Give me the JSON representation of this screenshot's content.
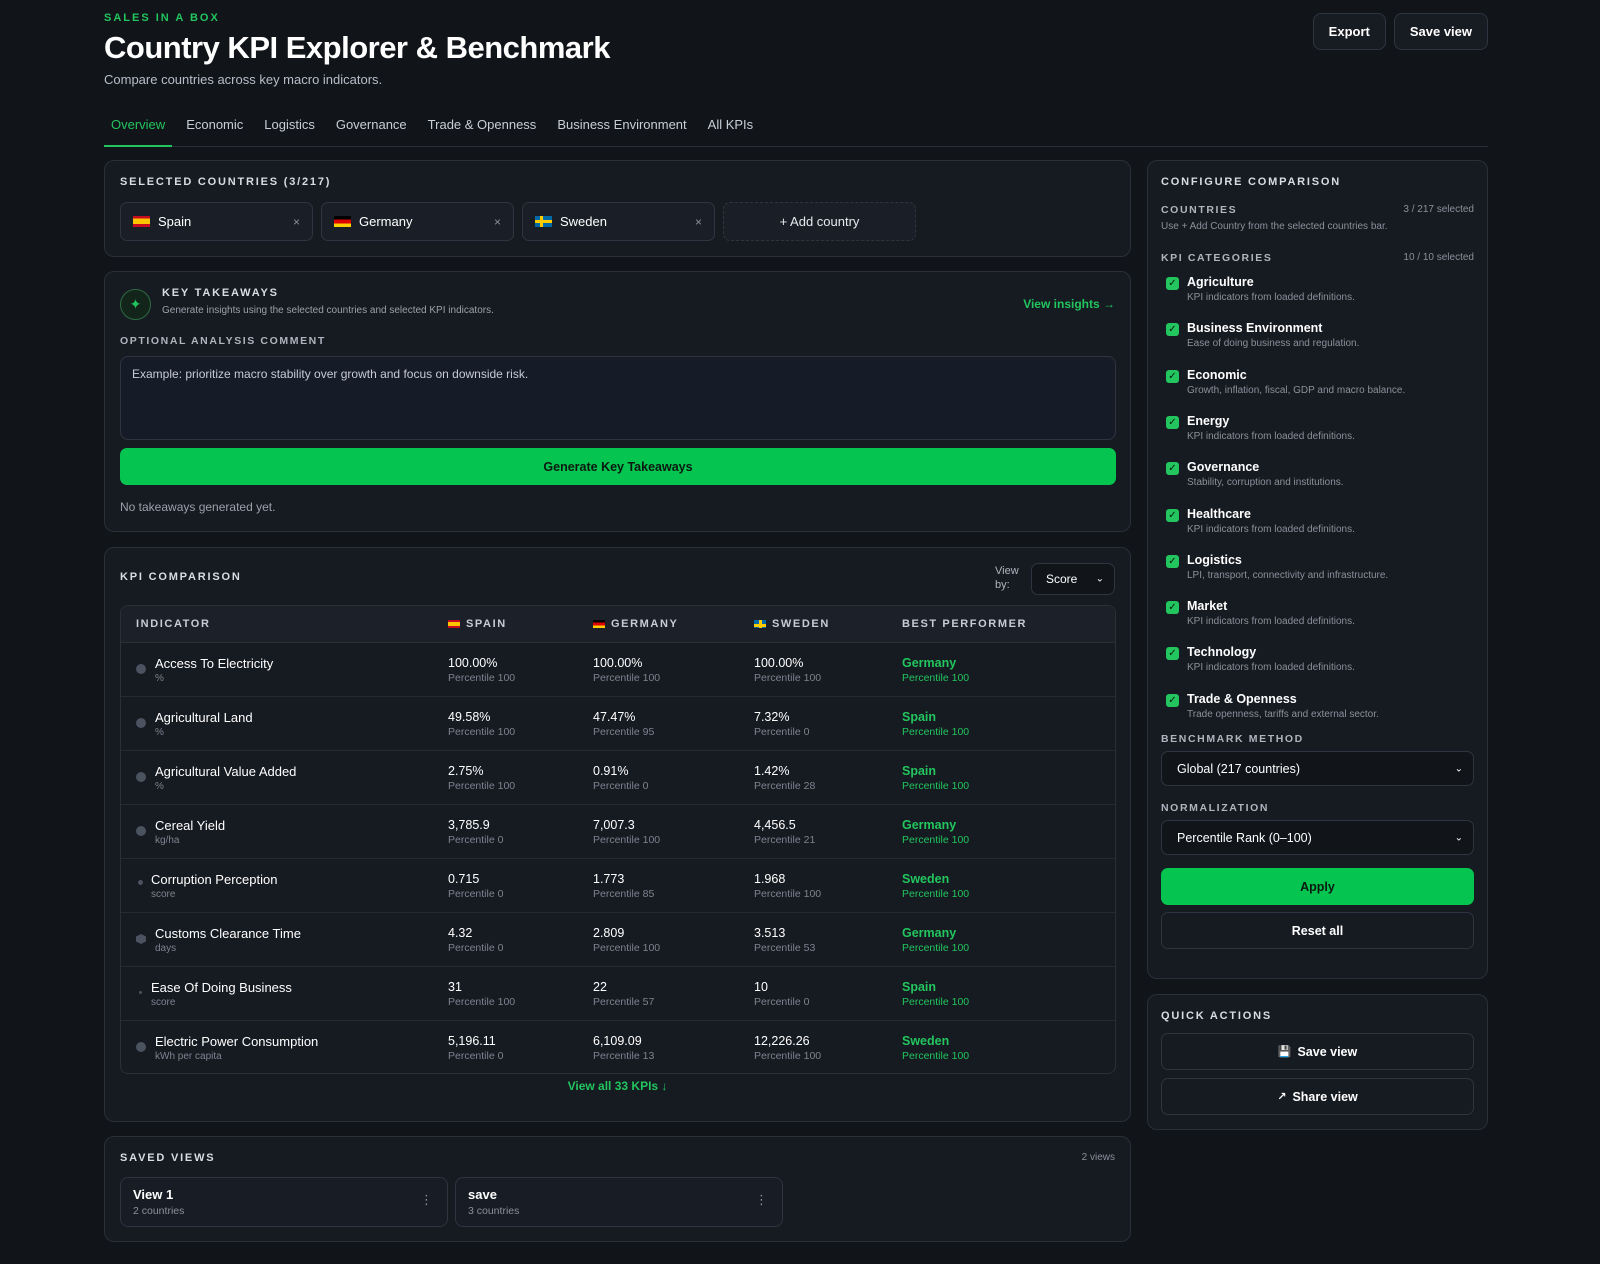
{
  "header": {
    "brand": "SALES IN A BOX",
    "title": "Country KPI Explorer & Benchmark",
    "subtitle": "Compare countries across key macro indicators.",
    "export_label": "Export",
    "save_view_label": "Save view"
  },
  "tabs": [
    {
      "label": "Overview",
      "active": true
    },
    {
      "label": "Economic"
    },
    {
      "label": "Logistics"
    },
    {
      "label": "Governance"
    },
    {
      "label": "Trade & Openness"
    },
    {
      "label": "Business Environment"
    },
    {
      "label": "All KPIs"
    }
  ],
  "selected": {
    "title": "SELECTED COUNTRIES (3/217)",
    "chips": [
      {
        "name": "Spain",
        "flag": "es-flag-icon",
        "remove": "×"
      },
      {
        "name": "Germany",
        "flag": "de-flag-icon",
        "remove": "×"
      },
      {
        "name": "Sweden",
        "flag": "se-flag-icon",
        "remove": "×"
      }
    ],
    "add_label": "+ Add country"
  },
  "takeaways": {
    "icon": "✦",
    "title": "KEY TAKEAWAYS",
    "subtitle": "Generate insights using the selected countries and selected KPI indicators.",
    "view_link": "View insights →",
    "comment_label": "OPTIONAL ANALYSIS COMMENT",
    "comment_placeholder": "Example: prioritize macro stability over growth and focus on downside risk.",
    "generate_label": "Generate Key Takeaways",
    "empty": "No takeaways generated yet."
  },
  "kpi": {
    "title": "KPI COMPARISON",
    "view_by_label": "View by:",
    "view_by_value": "Score",
    "headers": {
      "indicator": "INDICATOR",
      "spain": "SPAIN",
      "germany": "GERMANY",
      "sweden": "SWEDEN",
      "best": "BEST PERFORMER"
    },
    "rows": [
      {
        "name": "Access To Electricity",
        "unit": "%",
        "es": "100.00%",
        "es_p": "Percentile 100",
        "de": "100.00%",
        "de_p": "Percentile 100",
        "se": "100.00%",
        "se_p": "Percentile 100",
        "best": "Germany",
        "best_p": "Percentile 100"
      },
      {
        "name": "Agricultural Land",
        "unit": "%",
        "es": "49.58%",
        "es_p": "Percentile 100",
        "de": "47.47%",
        "de_p": "Percentile 95",
        "se": "7.32%",
        "se_p": "Percentile 0",
        "best": "Spain",
        "best_p": "Percentile 100"
      },
      {
        "name": "Agricultural Value Added",
        "unit": "%",
        "es": "2.75%",
        "es_p": "Percentile 100",
        "de": "0.91%",
        "de_p": "Percentile 0",
        "se": "1.42%",
        "se_p": "Percentile 28",
        "best": "Spain",
        "best_p": "Percentile 100"
      },
      {
        "name": "Cereal Yield",
        "unit": "kg/ha",
        "es": "3,785.9",
        "es_p": "Percentile 0",
        "de": "7,007.3",
        "de_p": "Percentile 100",
        "se": "4,456.5",
        "se_p": "Percentile 21",
        "best": "Germany",
        "best_p": "Percentile 100"
      },
      {
        "name": "Corruption Perception",
        "unit": "score",
        "es": "0.715",
        "es_p": "Percentile 0",
        "de": "1.773",
        "de_p": "Percentile 85",
        "se": "1.968",
        "se_p": "Percentile 100",
        "best": "Sweden",
        "best_p": "Percentile 100"
      },
      {
        "name": "Customs Clearance Time",
        "unit": "days",
        "es": "4.32",
        "es_p": "Percentile 0",
        "de": "2.809",
        "de_p": "Percentile 100",
        "se": "3.513",
        "se_p": "Percentile 53",
        "best": "Germany",
        "best_p": "Percentile 100"
      },
      {
        "name": "Ease Of Doing Business",
        "unit": "score",
        "es": "31",
        "es_p": "Percentile 100",
        "de": "22",
        "de_p": "Percentile 57",
        "se": "10",
        "se_p": "Percentile 0",
        "best": "Spain",
        "best_p": "Percentile 100"
      },
      {
        "name": "Electric Power Consumption",
        "unit": "kWh per capita",
        "es": "5,196.11",
        "es_p": "Percentile 0",
        "de": "6,109.09",
        "de_p": "Percentile 13",
        "se": "12,226.26",
        "se_p": "Percentile 100",
        "best": "Sweden",
        "best_p": "Percentile 100"
      }
    ],
    "view_all": "View all 33 KPIs ↓"
  },
  "saved_views": {
    "title": "SAVED VIEWS",
    "count": "2 views",
    "items": [
      {
        "name": "View 1",
        "sub": "2 countries",
        "menu": "⋮"
      },
      {
        "name": "save",
        "sub": "3 countries",
        "menu": "⋮"
      }
    ]
  },
  "config": {
    "title": "CONFIGURE COMPARISON",
    "countries_label": "COUNTRIES",
    "countries_count": "3 / 217 selected",
    "countries_help": "Use + Add Country from the selected countries bar.",
    "categories_label": "KPI CATEGORIES",
    "categories_count": "10 / 10 selected",
    "categories": [
      {
        "name": "Agriculture",
        "desc": "KPI indicators from loaded definitions."
      },
      {
        "name": "Business Environment",
        "desc": "Ease of doing business and regulation."
      },
      {
        "name": "Economic",
        "desc": "Growth, inflation, fiscal, GDP and macro balance."
      },
      {
        "name": "Energy",
        "desc": "KPI indicators from loaded definitions."
      },
      {
        "name": "Governance",
        "desc": "Stability, corruption and institutions."
      },
      {
        "name": "Healthcare",
        "desc": "KPI indicators from loaded definitions."
      },
      {
        "name": "Logistics",
        "desc": "LPI, transport, connectivity and infrastructure."
      },
      {
        "name": "Market",
        "desc": "KPI indicators from loaded definitions."
      },
      {
        "name": "Technology",
        "desc": "KPI indicators from loaded definitions."
      },
      {
        "name": "Trade & Openness",
        "desc": "Trade openness, tariffs and external sector."
      }
    ],
    "benchmark_label": "BENCHMARK METHOD",
    "benchmark_value": "Global (217 countries)",
    "normalization_label": "NORMALIZATION",
    "normalization_value": "Percentile Rank (0–100)",
    "apply_label": "Apply",
    "reset_label": "Reset all"
  },
  "quick_actions": {
    "title": "QUICK ACTIONS",
    "save_label": "Save view",
    "share_label": "Share view"
  },
  "icons": {
    "check": "✓",
    "chevron": "⌄",
    "save": "💾",
    "share": "↗"
  },
  "colors": {
    "accent": "#22c55e",
    "button_green": "#05c44f",
    "background": "#111419",
    "card": "#161a21"
  }
}
